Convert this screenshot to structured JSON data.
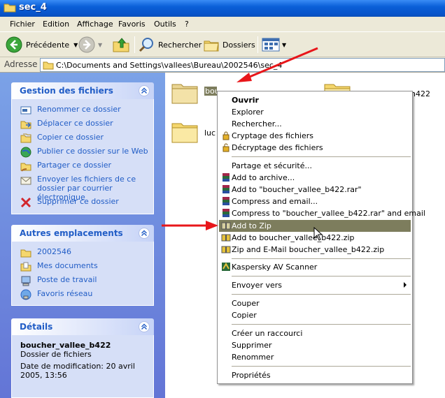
{
  "window": {
    "title": "sec_4"
  },
  "menubar": {
    "items": [
      "Fichier",
      "Edition",
      "Affichage",
      "Favoris",
      "Outils",
      "?"
    ]
  },
  "toolbar": {
    "back_label": "Précédente",
    "search_label": "Rechercher",
    "folders_label": "Dossiers"
  },
  "address": {
    "label": "Adresse",
    "path": "C:\\Documents and Settings\\vallees\\Bureau\\2002546\\sec_4"
  },
  "tasks": {
    "file_tasks": {
      "title": "Gestion des fichiers",
      "items": [
        "Renommer ce dossier",
        "Déplacer ce dossier",
        "Copier ce dossier",
        "Publier ce dossier sur le Web",
        "Partager ce dossier",
        "Envoyer les fichiers de ce dossier par courrier électronique",
        "Supprimer ce dossier"
      ]
    },
    "other_places": {
      "title": "Autres emplacements",
      "items": [
        "2002546",
        "Mes documents",
        "Poste de travail",
        "Favoris réseau"
      ]
    },
    "details": {
      "title": "Détails",
      "name": "boucher_vallee_b422",
      "type": "Dossier de fichiers",
      "modified": "Date de modification: 20 avril 2005, 13:56"
    }
  },
  "files": {
    "folder1_label": "boucher_vallee_b422",
    "folder2_label": "luc",
    "folder3_label": "boucher_vallee_h422"
  },
  "context_menu": {
    "items": [
      "Ouvrir",
      "Explorer",
      "Rechercher...",
      "Cryptage des fichiers",
      "Décryptage des fichiers",
      "Partage et sécurité...",
      "Add to archive...",
      "Add to \"boucher_vallee_b422.rar\"",
      "Compress and email...",
      "Compress to \"boucher_vallee_b422.rar\" and email",
      "Add to Zip",
      "Add to boucher_vallee_b422.zip",
      "Zip and E-Mail boucher_vallee_b422.zip",
      "Kaspersky AV Scanner",
      "Envoyer vers",
      "Couper",
      "Copier",
      "Créer un raccourci",
      "Supprimer",
      "Renommer",
      "Propriétés"
    ]
  },
  "colors": {
    "titlebar": "#0a5fd8",
    "taskpane": "#6375d6",
    "highlight": "#7d7d5d",
    "arrow": "#e8161a",
    "link": "#215dc6"
  }
}
